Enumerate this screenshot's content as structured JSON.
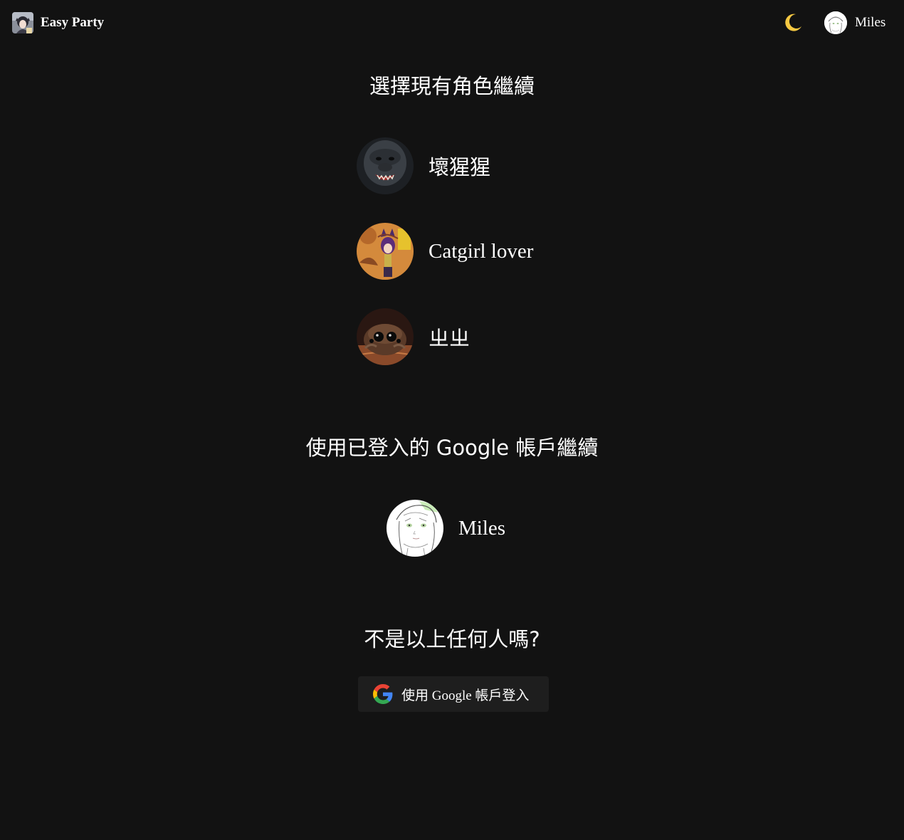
{
  "header": {
    "brand_name": "Easy Party",
    "theme_icon": "moon-icon",
    "user_name": "Miles"
  },
  "characters": {
    "title": "選擇現有角色繼續",
    "items": [
      {
        "name": "壞猩猩",
        "avatar": "gorilla-avatar"
      },
      {
        "name": "Catgirl lover",
        "avatar": "catgirl-avatar"
      },
      {
        "name": "ㄓㄓ",
        "avatar": "spider-avatar"
      }
    ]
  },
  "google_accounts": {
    "title": "使用已登入的 Google 帳戶繼續",
    "items": [
      {
        "name": "Miles",
        "avatar": "sketch-girl-avatar"
      }
    ]
  },
  "other": {
    "title": "不是以上任何人嗎?",
    "google_button_label": "使用 Google 帳戶登入",
    "google_icon": "google-g-icon"
  },
  "colors": {
    "background": "#121212",
    "button_background": "#1e1e1e",
    "text": "#ffffff",
    "moon": "#f5c842"
  }
}
